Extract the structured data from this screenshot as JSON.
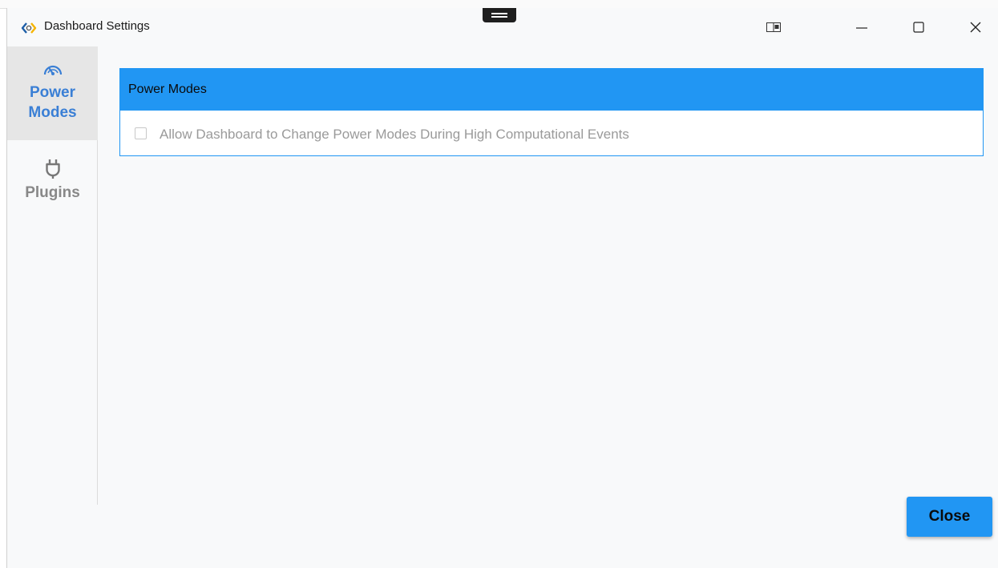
{
  "window": {
    "title": "Dashboard Settings"
  },
  "titlebar": {
    "icons": [
      "app-icon",
      "snap-layout-icon",
      "minimize-icon",
      "maximize-icon",
      "close-icon"
    ]
  },
  "sidebar": {
    "items": [
      {
        "label_line1": "Power",
        "label_line2": "Modes",
        "icon": "speedometer-icon",
        "active": true
      },
      {
        "label": "Plugins",
        "icon": "plug-icon",
        "active": false
      }
    ]
  },
  "power_modes": {
    "header": "Power Modes",
    "checkbox_label": "Allow Dashboard to Change Power Modes During High Computational Events",
    "checkbox_checked": false,
    "checkbox_enabled": false
  },
  "footer": {
    "close_label": "Close"
  },
  "colors": {
    "accent": "#2196f3",
    "active_nav_text": "#3a7fd5",
    "inactive_nav_text": "#888888",
    "disabled_text": "#9a9a9a"
  }
}
